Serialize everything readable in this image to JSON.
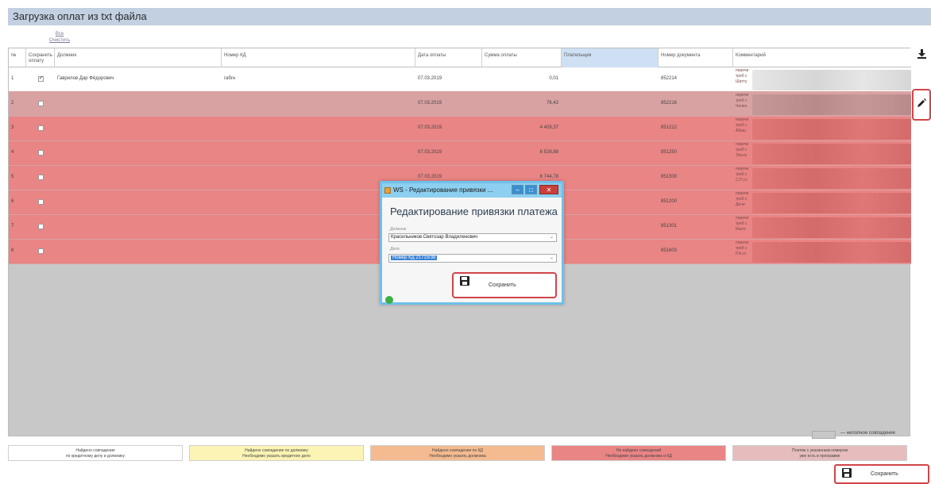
{
  "page": {
    "title": "Загрузка оплат из txt файла"
  },
  "select_links": {
    "all": "Все",
    "clear": "Очистить"
  },
  "table": {
    "headers": [
      "№",
      "Сохранить оплату",
      "Должник",
      "Номер КД",
      "Дата оплаты",
      "Сумма оплаты",
      "Плательщик",
      "Номер документа",
      "Комментарий"
    ],
    "rows": [
      {
        "n": "1",
        "checked": true,
        "debtor": "Гаврилов Дар Фёдорович",
        "kd": "габгн",
        "date": "07.03.2019",
        "amount": "0,01",
        "payer": "",
        "doc": "852214",
        "comment": [
          "перечи",
          "треб с",
          "Шатту"
        ],
        "status": "white"
      },
      {
        "n": "2",
        "checked": false,
        "debtor": "",
        "kd": "",
        "date": "07.03.2019",
        "amount": "76,43",
        "payer": "",
        "doc": "852216",
        "comment": [
          "перечи",
          "треб с",
          "Челен"
        ],
        "status": "pink"
      },
      {
        "n": "3",
        "checked": false,
        "debtor": "",
        "kd": "",
        "date": "07.03.2019",
        "amount": "4 409,37",
        "payer": "",
        "doc": "851212",
        "comment": [
          "перечи",
          "треб с",
          "Абаш"
        ],
        "status": "red"
      },
      {
        "n": "4",
        "checked": false,
        "debtor": "",
        "kd": "",
        "date": "07.03.2019",
        "amount": "6 528,88",
        "payer": "",
        "doc": "851250",
        "comment": [
          "перечи",
          "треб с",
          "Эльну"
        ],
        "status": "red"
      },
      {
        "n": "5",
        "checked": false,
        "debtor": "",
        "kd": "",
        "date": "07.03.2019",
        "amount": "6 744,78",
        "payer": "",
        "doc": "851300",
        "comment": [
          "перечи",
          "треб с",
          "С.П.сс"
        ],
        "status": "red"
      },
      {
        "n": "6",
        "checked": false,
        "debtor": "",
        "kd": "",
        "date": "",
        "amount": "",
        "payer": "",
        "doc": "851200",
        "comment": [
          "перечи",
          "треб с",
          "Дени"
        ],
        "status": "red"
      },
      {
        "n": "7",
        "checked": false,
        "debtor": "",
        "kd": "",
        "date": "",
        "amount": "",
        "payer": "",
        "doc": "851301",
        "comment": [
          "перечи",
          "треб с",
          "Иште"
        ],
        "status": "red"
      },
      {
        "n": "8",
        "checked": false,
        "debtor": "",
        "kd": "",
        "date": "",
        "amount": "",
        "payer": "",
        "doc": "851603",
        "comment": [
          "перечи",
          "треб с",
          "Р.А.сс"
        ],
        "status": "red"
      }
    ]
  },
  "colors": {
    "white": "#ffffff",
    "pink": "#d9a2a2",
    "red": "#e98585",
    "yellow": "#fbf4b4",
    "orange": "#f4bb90",
    "legend_red": "#e98585",
    "legend_pink": "#e6bcbc",
    "grid_bg": "#c8c8c8"
  },
  "legend": {
    "partial_note": "— неполное совпадение",
    "items": [
      {
        "line1": "Найдено совпадение",
        "line2": "по кредитному делу и должнику",
        "color": "#ffffff"
      },
      {
        "line1": "Найдено совпадение по должнику",
        "line2": "Необходимо указать кредитное дело",
        "color": "#fbf4b4"
      },
      {
        "line1": "Найдено совпадение по КД",
        "line2": "Необходимо указать должника",
        "color": "#f4bb90"
      },
      {
        "line1": "Не найдено совпадений",
        "line2": "Необходимо указать должника и КД",
        "color": "#e98585"
      },
      {
        "line1": "Платеж с указанным номером",
        "line2": "уже есть в программе",
        "color": "#e6bcbc"
      }
    ]
  },
  "side_icons": {
    "download": "download-icon",
    "edit": "pencil-icon"
  },
  "save_button": {
    "label": "Сохранить",
    "icon": "floppy-disk-icon"
  },
  "dialog": {
    "title": "WS - Редактирование привязки ...",
    "heading": "Редактирование привязки платежа",
    "debtor_label": "Должник",
    "debtor_value": "Красильников Святозар Владиленович",
    "case_label": "Дело",
    "case_value": "Номер КД 21715/38",
    "save_label": "Сохранить",
    "btn_min": "–",
    "btn_max": "□",
    "btn_close": "✕"
  }
}
